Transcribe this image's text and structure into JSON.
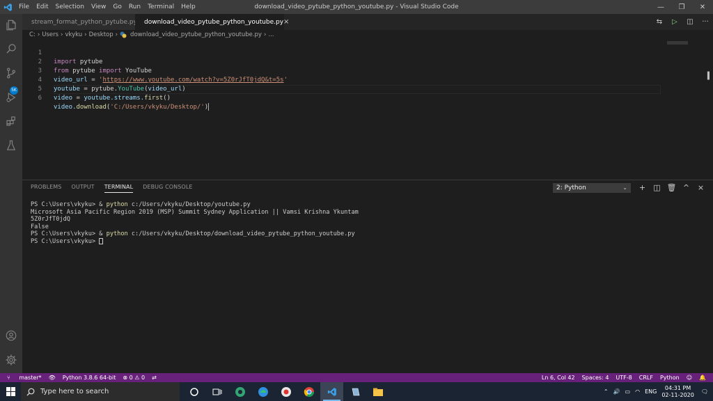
{
  "app": {
    "window_title": "download_video_pytube_python_youtube.py - Visual Studio Code",
    "menu": [
      "File",
      "Edit",
      "Selection",
      "View",
      "Go",
      "Run",
      "Terminal",
      "Help"
    ]
  },
  "activity_bar": {
    "icons": [
      "files-icon",
      "search-icon",
      "source-control-icon",
      "run-debug-icon",
      "extensions-icon",
      "testing-icon",
      "account-icon",
      "settings-gear-icon"
    ],
    "scm_badge": "5K"
  },
  "tabs": [
    {
      "label": "stream_format_python_pytube.py",
      "active": false
    },
    {
      "label": "download_video_pytube_python_youtube.py",
      "active": true,
      "close": "×"
    }
  ],
  "breadcrumb": [
    "C:",
    "Users",
    "vkyku",
    "Desktop",
    "download_video_pytube_python_youtube.py",
    "..."
  ],
  "editor": {
    "lines": [
      {
        "n": "1"
      },
      {
        "n": "2"
      },
      {
        "n": "3"
      },
      {
        "n": "4"
      },
      {
        "n": "5"
      },
      {
        "n": "6"
      }
    ],
    "tokens": {
      "l1_kw": "import",
      "l1_mod": " pytube",
      "l2_kw": "from",
      "l2_mod": " pytube ",
      "l2_kw2": "import",
      "l2_cls": " YouTube",
      "l3_var": "video_url",
      "l3_op": " = ",
      "l3_q1": "'",
      "l3_url": "https://www.youtube.com/watch?v=5Z0rJfT0jdQ&t=5s",
      "l3_q2": "'",
      "l4_var": "youtube",
      "l4_op": " = ",
      "l4_mod": "pytube.",
      "l4_cls": "YouTube",
      "l4_p1": "(",
      "l4_arg": "video_url",
      "l4_p2": ")",
      "l5_var": "video",
      "l5_op": " = ",
      "l5_obj": "youtube.",
      "l5_attr": "streams.",
      "l5_fn": "first",
      "l5_p": "()",
      "l6_obj": "video.",
      "l6_fn": "download",
      "l6_p1": "(",
      "l6_str": "'C:/Users/vkyku/Desktop/'",
      "l6_p2": ")"
    }
  },
  "panel": {
    "tabs": [
      "PROBLEMS",
      "OUTPUT",
      "TERMINAL",
      "DEBUG CONSOLE"
    ],
    "active_tab": "TERMINAL",
    "terminal_select": "2: Python",
    "actions": [
      "+",
      "split-icon",
      "trash-icon",
      "^",
      "×"
    ],
    "terminal_lines": [
      {
        "prompt": "PS C:\\Users\\vkyku> & ",
        "cmd": "python",
        "rest": " c:/Users/vkyku/Desktop/youtube.py"
      },
      {
        "prompt": "",
        "cmd": "",
        "rest": "Microsoft Asia Pacific Region 2019 (MSP) Summit Sydney Application || Vamsi Krishna Ykuntam"
      },
      {
        "prompt": "",
        "cmd": "",
        "rest": "5Z0rJfT0jdQ"
      },
      {
        "prompt": "",
        "cmd": "",
        "rest": "False"
      },
      {
        "prompt": "PS C:\\Users\\vkyku> & ",
        "cmd": "python",
        "rest": " c:/Users/vkyku/Desktop/download_video_pytube_python_youtube.py"
      },
      {
        "prompt": "PS C:\\Users\\vkyku> ",
        "cmd": "",
        "rest": ""
      }
    ]
  },
  "statusbar": {
    "branch": "master*",
    "interpreter": "Python 3.8.6 64-bit",
    "problems": "⊗ 0 ⚠ 0",
    "position": "Ln 6, Col 42",
    "spaces": "Spaces: 4",
    "encoding": "UTF-8",
    "eol": "CRLF",
    "language": "Python"
  },
  "taskbar": {
    "search_placeholder": "Type here to search",
    "language": "ENG",
    "time": "04:31 PM",
    "date": "02-11-2020"
  }
}
